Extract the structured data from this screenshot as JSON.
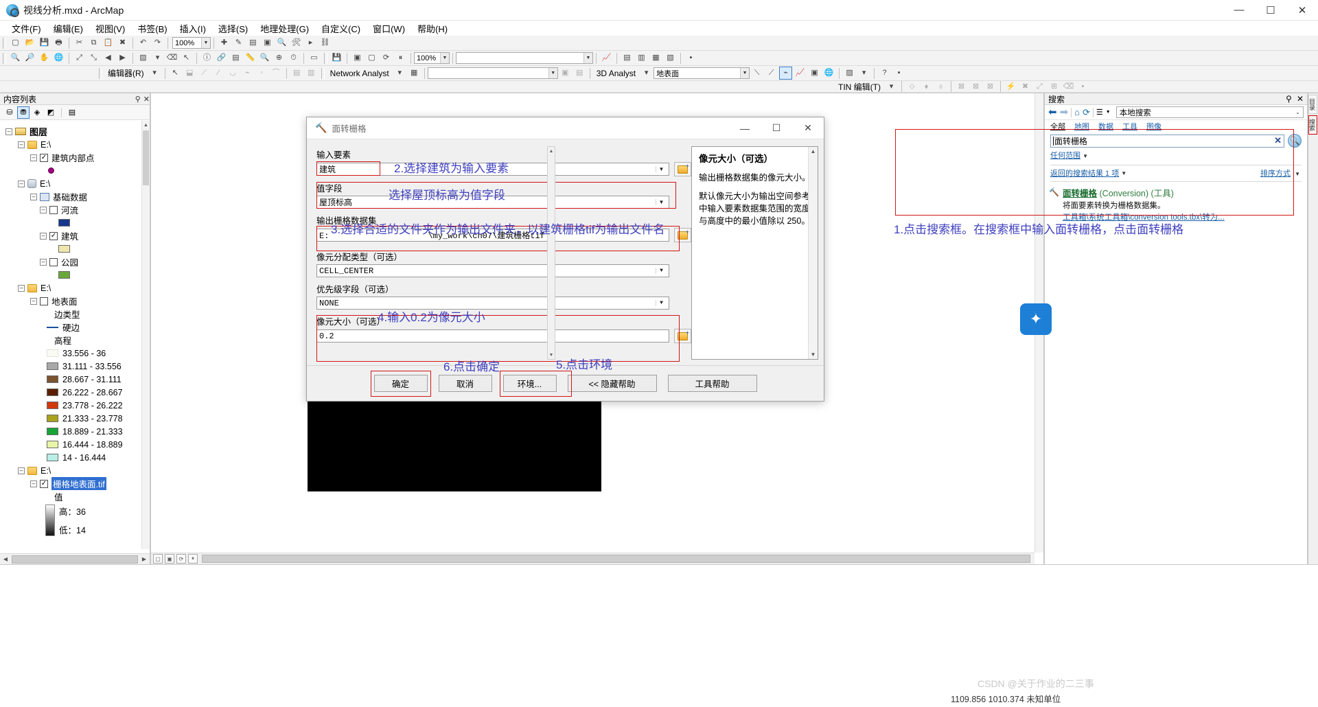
{
  "window": {
    "title": "视线分析.mxd - ArcMap",
    "minimize": "—",
    "maximize": "☐",
    "close": "✕"
  },
  "menubar": [
    {
      "label": "文件(F)"
    },
    {
      "label": "编辑(E)"
    },
    {
      "label": "视图(V)"
    },
    {
      "label": "书签(B)"
    },
    {
      "label": "插入(I)"
    },
    {
      "label": "选择(S)"
    },
    {
      "label": "地理处理(G)"
    },
    {
      "label": "自定义(C)"
    },
    {
      "label": "窗口(W)"
    },
    {
      "label": "帮助(H)"
    }
  ],
  "toolbars": {
    "zoom_value": "100%",
    "editor_label": "编辑器(R)",
    "network_analyst_label": "Network Analyst",
    "analyst3d_label": "3D Analyst",
    "analyst3d_layer": "地表面",
    "tin_label": "TIN 编辑(T)"
  },
  "toc": {
    "title": "内容列表",
    "pin_icon": "pin-icon",
    "close_icon": "close-icon",
    "tools": [
      "list-by-source-icon",
      "list-by-drawing-order-icon",
      "list-by-visibility-icon",
      "list-by-selection-icon",
      "options-icon"
    ],
    "root": "图层",
    "nodes": [
      {
        "label": "E:\\",
        "type": "folder"
      },
      {
        "label": "建筑内部点",
        "type": "layer",
        "checked": true
      },
      {
        "label": "E:\\",
        "type": "database"
      },
      {
        "label": "基础数据",
        "type": "featuredataset"
      },
      {
        "label": "河流",
        "type": "layer",
        "checked": false
      },
      {
        "label": "建筑",
        "type": "layer",
        "checked": true
      },
      {
        "label": "公园",
        "type": "layer",
        "checked": false
      },
      {
        "label": "E:\\",
        "type": "folder"
      },
      {
        "label": "地表面",
        "type": "layer",
        "checked": false
      }
    ],
    "surface_legend": {
      "edge_type_header": "边类型",
      "edge_type_item": "硬边",
      "elevation_header": "高程",
      "classes": [
        {
          "label": "33.556 - 36",
          "color": "#fbfbf6"
        },
        {
          "label": "31.111 - 33.556",
          "color": "#a8a8a8"
        },
        {
          "label": "28.667 - 31.111",
          "color": "#7a5330"
        },
        {
          "label": "26.222 - 28.667",
          "color": "#5c1f05"
        },
        {
          "label": "23.778 - 26.222",
          "color": "#d1380a"
        },
        {
          "label": "21.333 - 23.778",
          "color": "#a9a21c"
        },
        {
          "label": "18.889 - 21.333",
          "color": "#18a336"
        },
        {
          "label": "16.444 - 18.889",
          "color": "#e8f5a8"
        },
        {
          "label": "14 - 16.444",
          "color": "#b9eee6"
        }
      ]
    },
    "raster_folder": "E:\\",
    "raster_layer": "栅格地表面.tif",
    "raster_value_header": "值",
    "raster_high": "高：36",
    "raster_low": "低：14"
  },
  "dialog": {
    "title": "面转栅格",
    "title_icon": "hammer-icon",
    "minimize": "—",
    "maximize": "☐",
    "close": "✕",
    "fields": [
      {
        "label": "输入要素",
        "value": "建筑",
        "has_dropdown": true,
        "has_browse": true,
        "highlight": true
      },
      {
        "label": "值字段",
        "value": "屋顶标高",
        "has_dropdown": true,
        "has_browse": false,
        "highlight": true
      },
      {
        "label": "输出栅格数据集",
        "value": "E:                    \\my_work\\ch07\\建筑栅格tif",
        "has_dropdown": false,
        "has_browse": true,
        "highlight": true
      },
      {
        "label": "像元分配类型（可选）",
        "value": "CELL_CENTER",
        "has_dropdown": true,
        "has_browse": false,
        "highlight": false
      },
      {
        "label": "优先级字段（可选）",
        "value": "NONE",
        "has_dropdown": true,
        "has_browse": false,
        "highlight": false
      },
      {
        "label": "像元大小（可选）",
        "value": "0.2",
        "has_dropdown": false,
        "has_browse": true,
        "highlight": true
      }
    ],
    "help": {
      "heading": "像元大小（可选）",
      "paragraph1": "输出栅格数据集的像元大小。",
      "paragraph2": "默认像元大小为输出空间参考中输入要素数据集范围的宽度与高度中的最小值除以 250。"
    },
    "buttons": [
      {
        "label": "确定",
        "highlight": true
      },
      {
        "label": "取消",
        "highlight": false
      },
      {
        "label": "环境...",
        "highlight": true
      },
      {
        "label": "<< 隐藏帮助",
        "highlight": false
      },
      {
        "label": "工具帮助",
        "highlight": false
      }
    ]
  },
  "annotations": [
    {
      "id": "a1",
      "text": "1.点击搜索框。在搜索框中输入面转栅格，点击面转栅格"
    },
    {
      "id": "a2",
      "text": "2.选择建筑为输入要素"
    },
    {
      "id": "a3",
      "text": "选择屋顶标高为值字段"
    },
    {
      "id": "a4",
      "text": "3.选择合适的文件夹作为输出文件夹，以建筑栅格tif为输出文件名"
    },
    {
      "id": "a5",
      "text": "4.输入0.2为像元大小"
    },
    {
      "id": "a6",
      "text": "5.点击环境"
    },
    {
      "id": "a7",
      "text": "6.点击确定"
    }
  ],
  "search": {
    "title": "搜索",
    "pin_icon": "pin-icon",
    "close_icon": "close-icon",
    "back_icon": "back-arrow-icon",
    "forward_icon": "forward-arrow-icon",
    "home_icon": "home-icon",
    "refresh_icon": "refresh-icon",
    "list_icon": "list-icon",
    "scope": "本地搜索",
    "tabs": [
      "全部",
      "地图",
      "数据",
      "工具",
      "图像"
    ],
    "query": "面转栅格",
    "clear_icon": "clear-x-icon",
    "go_icon": "search-icon",
    "extent_filter": "任何范围",
    "result_count": "返回的搜索结果 1 项",
    "sort_label": "排序方式",
    "results": [
      {
        "icon": "hammer-icon",
        "name": "面转栅格",
        "toolbox": "(Conversion)",
        "kind": "(工具)",
        "description": "将面要素转换为栅格数据集。",
        "path": "工具箱\\系统工具箱\\conversion tools.tbx\\转为..."
      }
    ]
  },
  "dock_tabs": [
    "目录",
    "搜索"
  ],
  "statusbar": {
    "coords": "1109.856  1010.374 未知单位"
  },
  "watermark": "CSDN @关于作业的二三事",
  "colors": {
    "annotation": "#4040c0",
    "highlight": "#d21414",
    "selection": "#2f6fd0",
    "link": "#1b5fa8"
  }
}
